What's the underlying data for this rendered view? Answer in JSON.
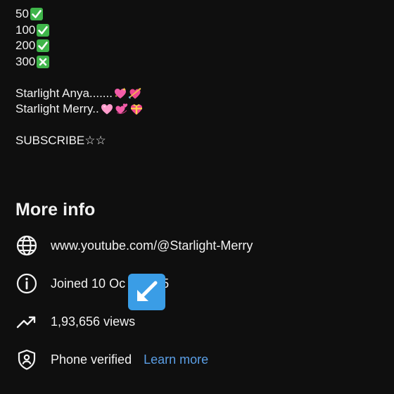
{
  "about": {
    "line1_text": "50",
    "line1_emoji": "check-mark-button",
    "line2_text": "100",
    "line2_emoji": "check-mark-button",
    "line3_text": "200",
    "line3_emoji": "check-mark-button",
    "line4_text": "300",
    "line4_emoji": "cross-mark-button",
    "line5_text": "Starlight Anya.......",
    "line5_emojis": [
      "sparkling-heart",
      "heart-with-arrow"
    ],
    "line6_text": "Starlight Merry..",
    "line6_emojis": [
      "pink-heart",
      "revolving-hearts",
      "heart-with-ribbon"
    ],
    "line7_text": "SUBSCRIBE☆☆"
  },
  "more_info": {
    "title": "More info",
    "channel_url": "www.youtube.com/@Starlight-Merry",
    "joined": "Joined 10 Oc",
    "joined_tail": "5",
    "views": "1,93,656 views",
    "phone": "Phone verified",
    "learn_more": "Learn more"
  },
  "icons": {
    "globe": "globe-icon",
    "info": "info-icon",
    "trending": "trending-up-icon",
    "verified": "shield-person-icon",
    "overlay": "down-left-arrow-emoji"
  },
  "colors": {
    "background": "#0f0f0f",
    "text": "#f1f1f1",
    "link": "#5b9fe6",
    "check_green": "#3fb54a",
    "cross_green": "#3fb54a",
    "overlay_blue": "#3a9de6"
  }
}
